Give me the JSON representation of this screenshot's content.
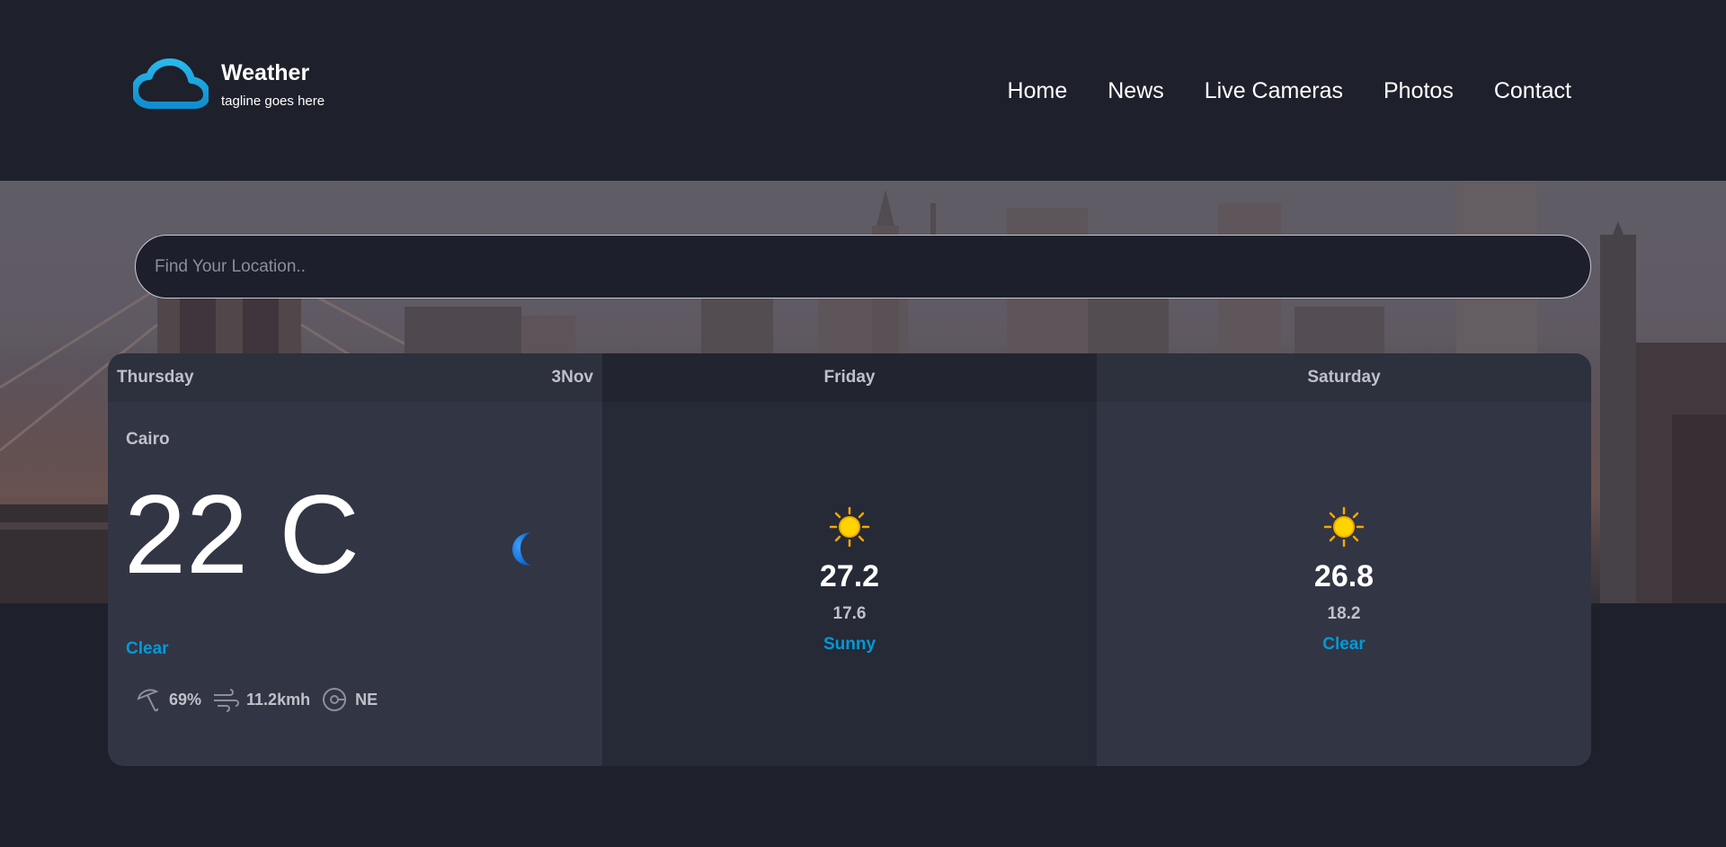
{
  "brand": {
    "title": "Weather",
    "tagline": "tagline goes here",
    "logo_icon": "cloud-icon",
    "logo_color": "#1aa7e0"
  },
  "nav": {
    "items": [
      {
        "label": "Home"
      },
      {
        "label": "News"
      },
      {
        "label": "Live Cameras"
      },
      {
        "label": "Photos"
      },
      {
        "label": "Contact"
      }
    ]
  },
  "search": {
    "placeholder": "Find Your Location..",
    "value": ""
  },
  "forecast": {
    "today": {
      "day": "Thursday",
      "date": "3Nov",
      "city": "Cairo",
      "temperature": "22 C",
      "icon": "moon-icon",
      "condition": "Clear",
      "humidity": "69%",
      "wind_speed": "11.2kmh",
      "wind_direction": "NE"
    },
    "days": [
      {
        "day": "Friday",
        "icon": "sun-icon",
        "high": "27.2",
        "low": "17.6",
        "condition": "Sunny"
      },
      {
        "day": "Saturday",
        "icon": "sun-icon",
        "high": "26.8",
        "low": "18.2",
        "condition": "Clear"
      }
    ]
  },
  "colors": {
    "background": "#1e202b",
    "accent": "#009ad8",
    "card_dark": "#262936",
    "card_light": "#323544"
  }
}
